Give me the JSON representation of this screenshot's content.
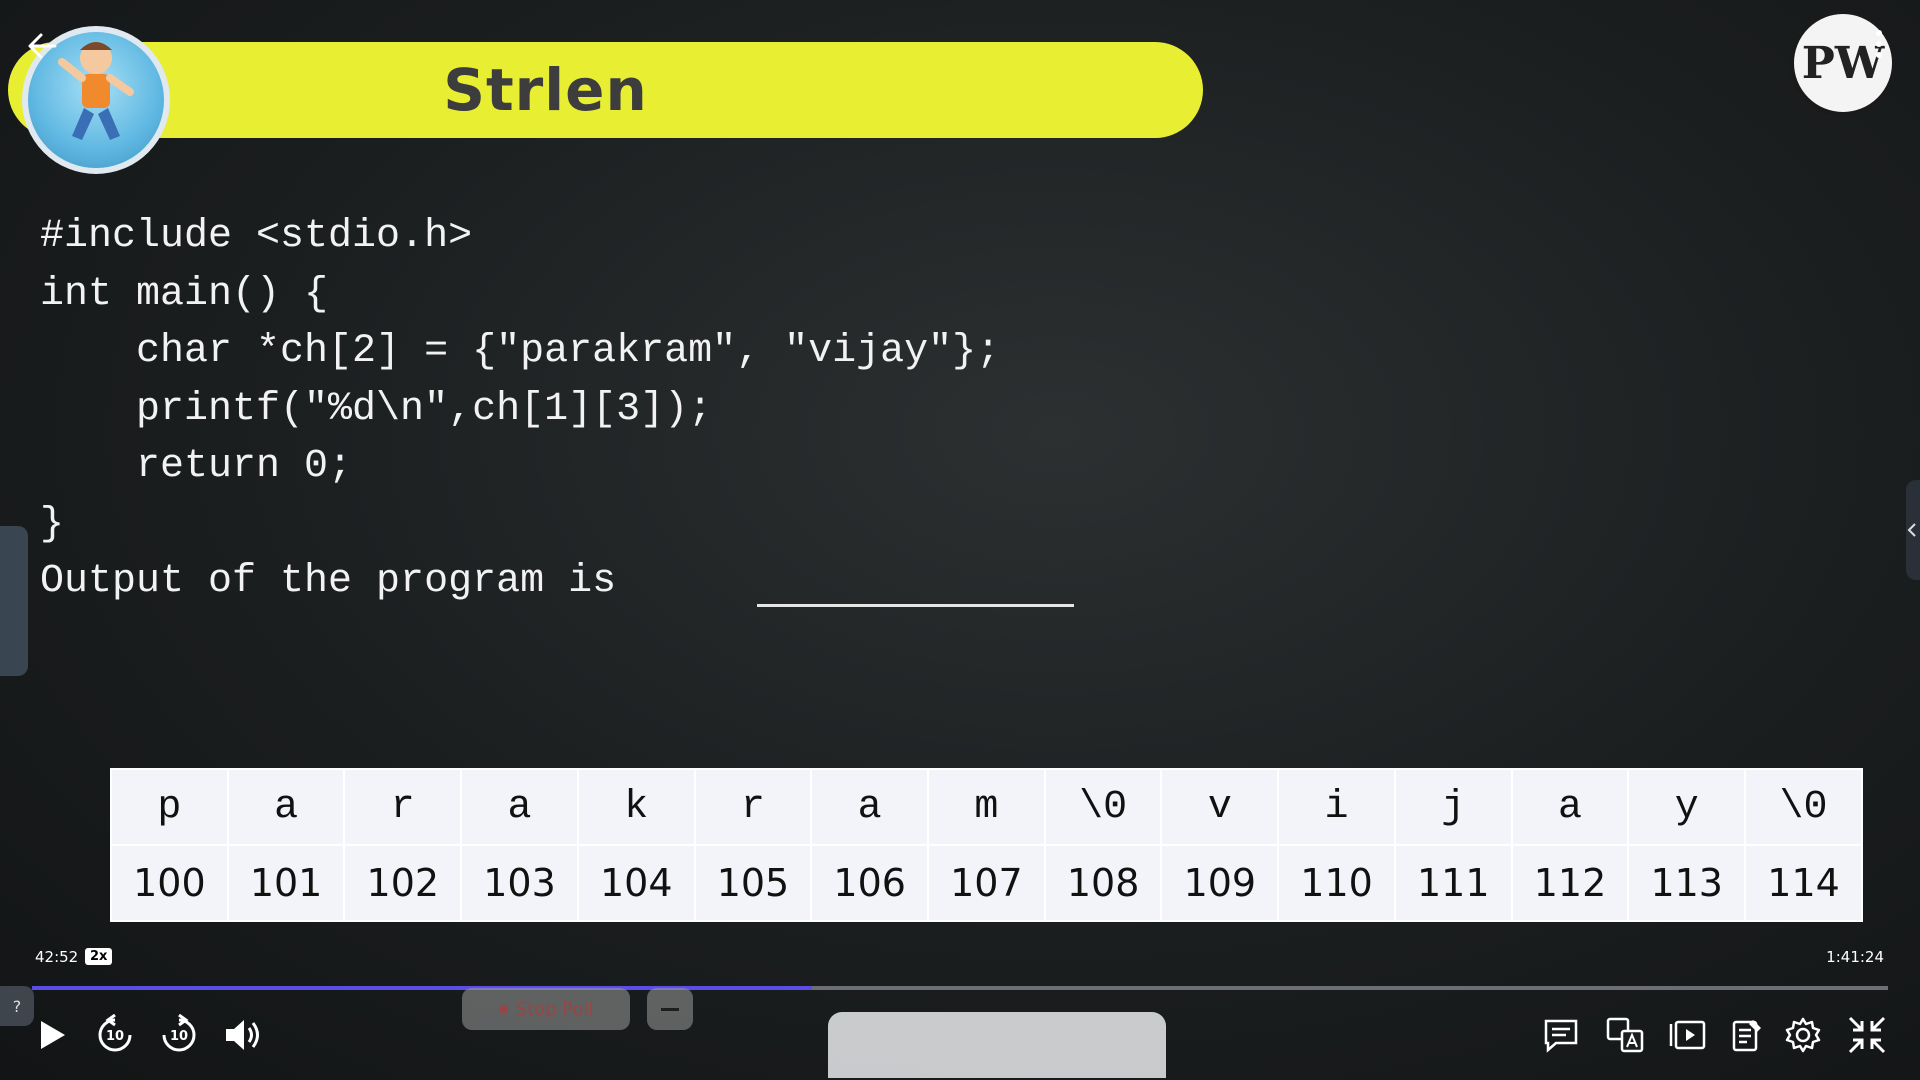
{
  "slide": {
    "title": "Strlen",
    "code_lines": [
      "#include <stdio.h>",
      "int main() {",
      "    char *ch[2] = {\"parakram\", \"vijay\"};",
      "    printf(\"%d\\n\",ch[1][3]);",
      "    return 0;",
      "}",
      "Output of the program is"
    ],
    "memory": {
      "chars": [
        "p",
        "a",
        "r",
        "a",
        "k",
        "r",
        "a",
        "m",
        "\\0",
        "v",
        "i",
        "j",
        "a",
        "y",
        "\\0"
      ],
      "addresses": [
        "100",
        "101",
        "102",
        "103",
        "104",
        "105",
        "106",
        "107",
        "108",
        "109",
        "110",
        "111",
        "112",
        "113",
        "114"
      ]
    },
    "logo_text": "PW"
  },
  "player": {
    "current_time": "42:52",
    "speed": "2x",
    "total_time": "1:41:24",
    "progress_fraction": 0.42,
    "stop_poll_label": "Stop Poll",
    "help_label": "?",
    "skip_back_label": "10",
    "skip_forward_label": "10",
    "accent_color": "#5b4ee6"
  }
}
